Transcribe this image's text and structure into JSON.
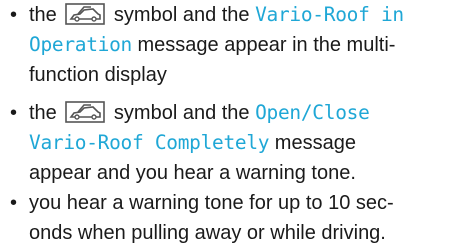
{
  "bullets": [
    {
      "line1_before": "the ",
      "line1_mid": " symbol and the ",
      "msg_part1": "Vario-Roof in",
      "msg_part2": "Operation",
      "line2_after": " message appear in the multi-",
      "line3": "function display"
    },
    {
      "line1_before": "the ",
      "line1_mid": " symbol and the ",
      "msg_part1": "Open/Close",
      "msg_part2": "Vario-Roof Completely",
      "line2_after": " message",
      "line3": "appear and you hear a warning tone."
    },
    {
      "line1": "you hear a warning tone for up to 10 sec-",
      "line2": "onds when pulling away or while driving."
    }
  ],
  "bullet_char": "•",
  "icons": {
    "roof": "convertible-roof-icon"
  },
  "colors": {
    "message": "#1fa7d6",
    "text": "#1a1a1a"
  }
}
